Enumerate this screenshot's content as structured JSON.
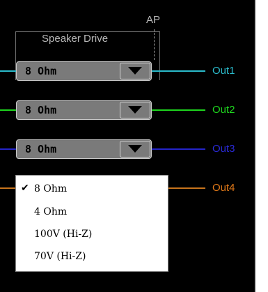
{
  "group": {
    "title": "Speaker Drive",
    "ap_label": "AP"
  },
  "rows": [
    {
      "value": "8 Ohm",
      "output": "Out1",
      "wire_color": "#2bbccc",
      "label_color": "#2bbccc"
    },
    {
      "value": "8 Ohm",
      "output": "Out2",
      "wire_color": "#1ed61e",
      "label_color": "#1ed61e"
    },
    {
      "value": "8 Ohm",
      "output": "Out3",
      "wire_color": "#2424c8",
      "label_color": "#2a2ad8"
    },
    {
      "value": "",
      "output": "Out4",
      "wire_color": "#c8741c",
      "label_color": "#e07818"
    }
  ],
  "dropdown": {
    "selected": "8 Ohm",
    "check_icon": "checkmark-icon",
    "options": [
      "8 Ohm",
      "4 Ohm",
      "100V (Hi-Z)",
      "70V (Hi-Z)"
    ]
  }
}
